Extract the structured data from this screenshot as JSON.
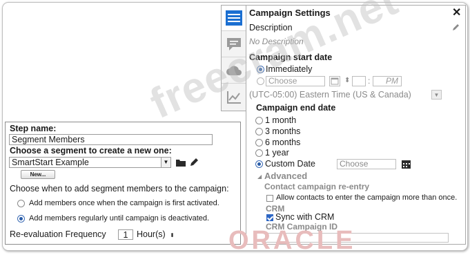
{
  "segment_panel": {
    "step_name_label": "Step name:",
    "step_name_value": "Segment Members",
    "choose_segment_label": "Choose a segment to create a new one:",
    "segment_selected": "SmartStart Example",
    "new_button_label": "New...",
    "choose_when_label": "Choose when to add segment members to the campaign:",
    "option_once_label": "Add members once when the campaign is first activated.",
    "option_regular_label": "Add members regularly until campaign is deactivated.",
    "reeval_label": "Re-evaluation Frequency",
    "reeval_value": "1",
    "reeval_unit": "Hour(s)"
  },
  "side_tabs": [
    "settings-icon",
    "comment-icon",
    "cloud-icon",
    "chart-icon"
  ],
  "settings_panel": {
    "title": "Campaign Settings",
    "description_label": "Description",
    "description_placeholder": "No Description",
    "start_date_label": "Campaign start date",
    "start_immediately": "Immediately",
    "start_choose_placeholder": "Choose",
    "time_ampm": "PM",
    "timezone": "(UTC-05:00) Eastern Time (US & Canada)",
    "end_date_label": "Campaign end date",
    "end_options": [
      "1 month",
      "3 months",
      "6 months",
      "1 year"
    ],
    "end_custom": "Custom Date",
    "end_choose_placeholder": "Choose",
    "advanced_label": "Advanced",
    "reentry_label": "Contact campaign re-entry",
    "reentry_checkbox_label": "Allow contacts to enter the campaign more than once.",
    "crm_label": "CRM",
    "sync_crm_label": "Sync with CRM",
    "crm_campaign_id_label": "CRM Campaign ID"
  },
  "watermark": "freecram.net",
  "logo_text": "ORACLE",
  "colors": {
    "accent_blue": "#2d66c4",
    "tab_active": "#1b6fd1",
    "logo_red": "#e8bcbc"
  }
}
